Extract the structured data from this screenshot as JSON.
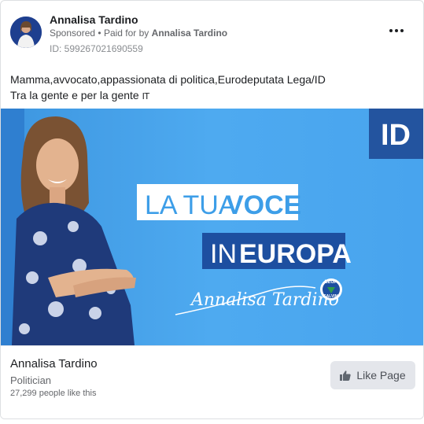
{
  "post": {
    "page_name": "Annalisa Tardino",
    "sponsored_label": "Sponsored",
    "separator": "•",
    "paid_for_prefix": "Paid for by",
    "paid_for_name": "Annalisa Tardino",
    "ad_id": "ID: 599267021690559",
    "more_icon": "more-horizontal-icon"
  },
  "message": {
    "line1": "Mamma,avvocato,appassionata di politica,Eurodeputata Lega/ID",
    "line2_text": "Tra la gente e per la gente",
    "line2_flag": "IT"
  },
  "creative": {
    "headline_1_light": "LA TUA",
    "headline_1_bold": "VOCE",
    "headline_2_light": "IN",
    "headline_2_bold": "EUROPA",
    "signature": "Annalisa Tardino",
    "party_badge_top": "LEGA",
    "party_badge_bottom": "SALVINI",
    "group_logo": "ID",
    "colors": {
      "background": "#4aa6ec",
      "box_dark": "#1d4fa0",
      "logo_bg": "#23549f"
    }
  },
  "footer": {
    "title": "Annalisa Tardino",
    "category": "Politician",
    "likes": "27,299 people like this",
    "like_button": "Like Page",
    "like_icon": "thumbs-up-icon"
  }
}
